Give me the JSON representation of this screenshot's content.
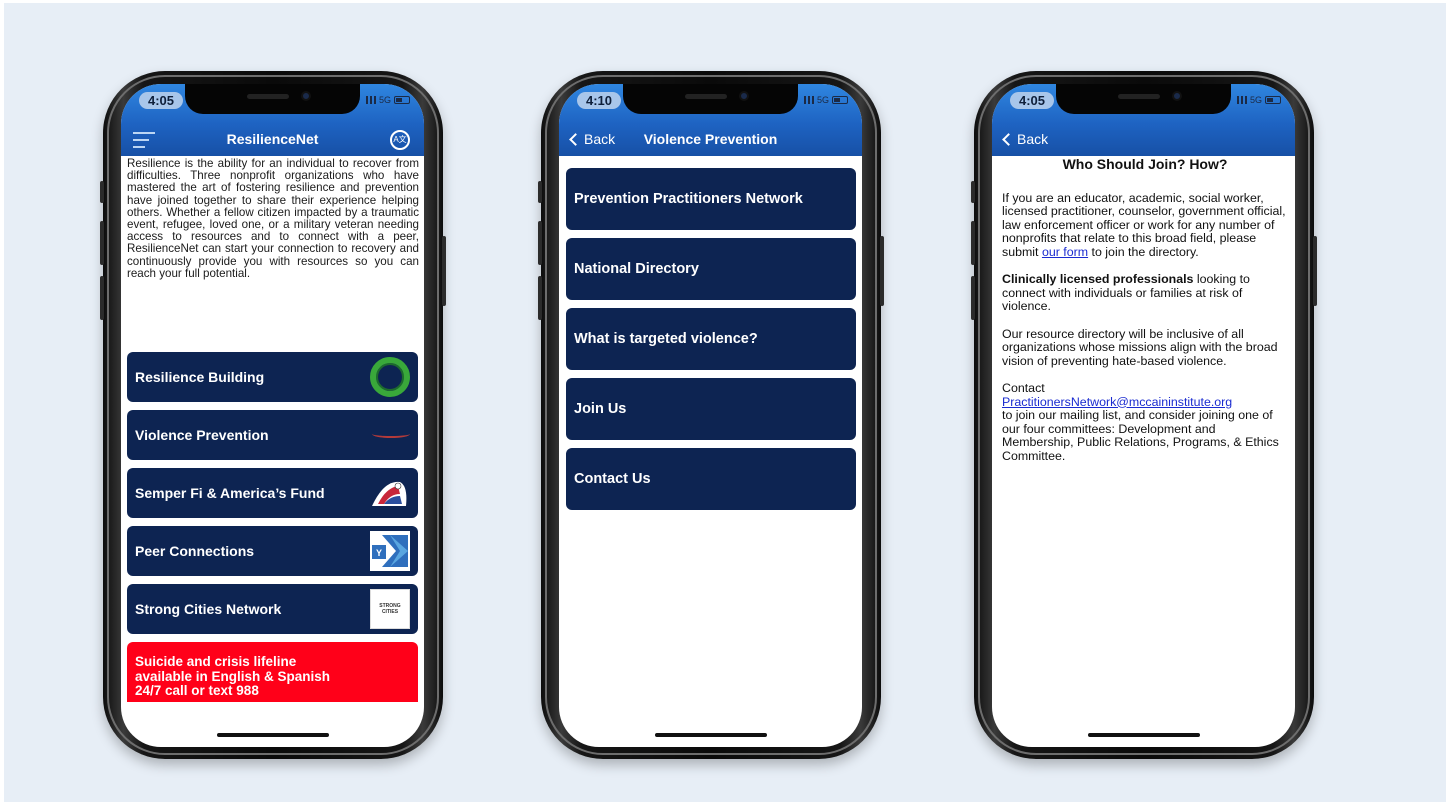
{
  "phones": [
    {
      "time": "4:05",
      "network": "5G",
      "nav_title": "ResilienceNet",
      "intro": "Resilience is the ability for an individual to recover from difficulties. Three nonprofit organizations who have mastered the art of fostering resilience and prevention have joined together to share their experience helping others. Whether a fellow citizen impacted by a traumatic event, refugee, loved one, or a military veteran needing access to resources and to connect with a peer, ResilienceNet can start your connection to recovery and continuously provide you with resources so you can reach your full potential.",
      "menu": [
        {
          "label": "Resilience Building",
          "icon": "green-ring-logo"
        },
        {
          "label": "Violence Prevention",
          "icon": "red-swoosh-logo"
        },
        {
          "label": "Semper Fi & America’s Fund",
          "icon": "eagle-flag-logo"
        },
        {
          "label": "Peer Connections",
          "icon": "y-logo"
        },
        {
          "label": "Strong Cities Network",
          "icon": "strong-cities-logo"
        }
      ],
      "strong_cities_logo_text": "STRONG CITIES",
      "y_logo_text": "Y",
      "chat_icon_text": "A文",
      "crisis_lines": [
        "Suicide and crisis lifeline",
        "available in English & Spanish",
        "24/7 call or text 988"
      ]
    },
    {
      "time": "4:10",
      "network": "5G",
      "back_label": "Back",
      "nav_title": "Violence Prevention",
      "menu": [
        "Prevention Practitioners Network",
        "National Directory",
        "What is targeted violence?",
        "Join Us",
        "Contact Us"
      ]
    },
    {
      "time": "4:05",
      "network": "5G",
      "back_label": "Back",
      "heading": "Who Should Join? How?",
      "para1_before": "If you are an educator, academic, social worker, licensed practitioner, counselor, government official, law enforcement officer or work for any number of nonprofits that relate to this broad field, please submit ",
      "para1_link": "our form",
      "para1_after": " to join the directory.",
      "para2_bold": "Clinically licensed professionals",
      "para2_rest": " looking to connect with individuals or families at risk of violence.",
      "para3": "Our resource directory will be inclusive of all organizations whose missions align with the broad vision of preventing hate-based violence.",
      "para4_before": "Contact",
      "para4_link": "PractitionersNetwork@mccaininstitute.org",
      "para4_after": "to join our mailing list, and consider joining one of our four committees: Development and Membership, Public Relations, Programs, & Ethics Committee."
    }
  ],
  "colors": {
    "background": "#e7eef6",
    "nav_blue": "#1e63c2",
    "menu_navy": "#0d2452",
    "crisis_red": "#ff0019",
    "link_blue": "#1a2bd0"
  }
}
